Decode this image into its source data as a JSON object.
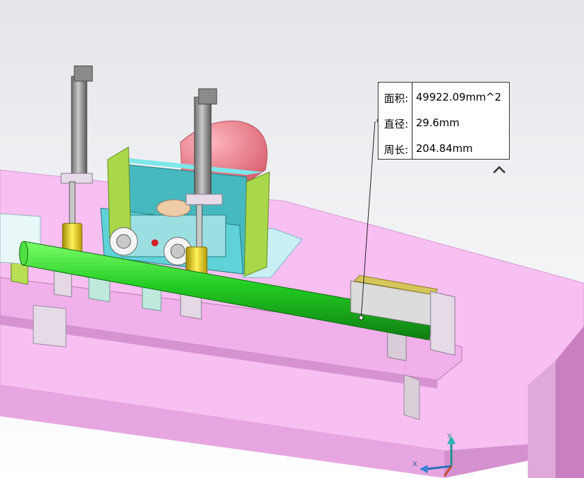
{
  "measure_callout": {
    "rows": [
      {
        "key": "面积:",
        "value": "49922.09mm^2"
      },
      {
        "key": "直径:",
        "value": "29.6mm"
      },
      {
        "key": "周长:",
        "value": "204.84mm"
      }
    ]
  },
  "axis_triad": {
    "y_label": "Y",
    "x_label": "X"
  },
  "colors": {
    "table_top": "#f4b8f0",
    "table_edge": "#c98ac3",
    "shaft": "#22cc22",
    "frame": "#5cc8c8",
    "cylinder_body": "#9a9a9a",
    "collar": "#e6d21a",
    "motor": "#ef8a96",
    "side_plate": "#a8d84a"
  }
}
